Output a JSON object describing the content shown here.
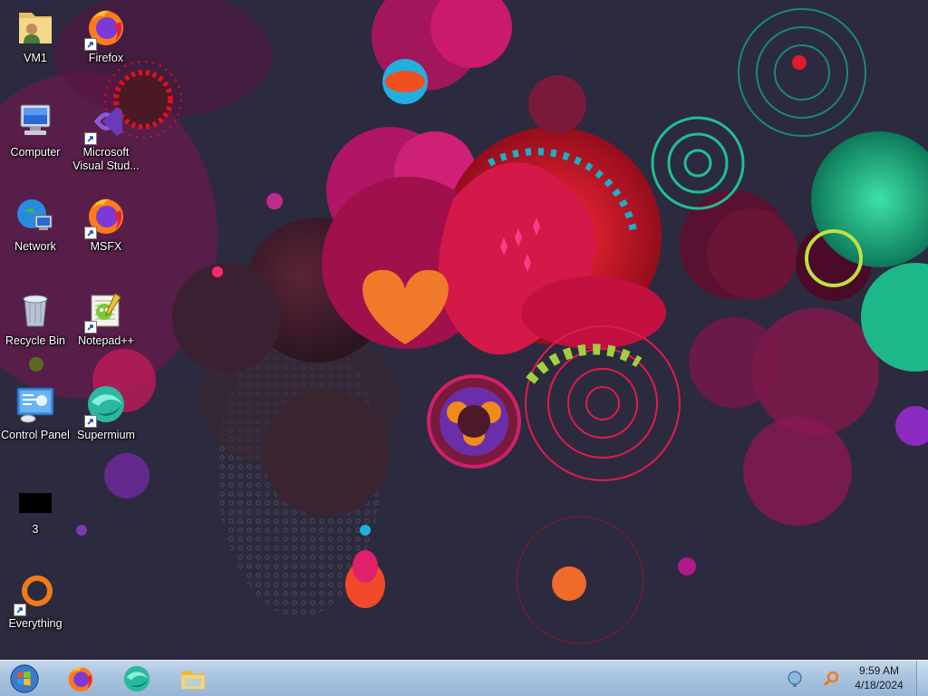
{
  "desktop": {
    "icons": [
      {
        "label": "VM1",
        "icon": "user-folder-icon"
      },
      {
        "label": "Firefox",
        "icon": "firefox-icon"
      },
      {
        "label": "Computer",
        "icon": "computer-icon"
      },
      {
        "label": "Microsoft Visual Stud...",
        "icon": "visual-studio-icon"
      },
      {
        "label": "Network",
        "icon": "network-icon"
      },
      {
        "label": "MSFX",
        "icon": "firefox-icon"
      },
      {
        "label": "Recycle Bin",
        "icon": "recycle-bin-icon"
      },
      {
        "label": "Notepad++",
        "icon": "notepad-plus-plus-icon"
      },
      {
        "label": "Control Panel",
        "icon": "control-panel-icon"
      },
      {
        "label": "Supermium",
        "icon": "supermium-icon"
      },
      {
        "label": "3",
        "icon": "black-file-icon"
      },
      {
        "label": "Everything",
        "icon": "everything-search-icon"
      }
    ]
  },
  "taskbar": {
    "pinned": [
      "firefox-icon",
      "supermium-icon",
      "file-explorer-icon"
    ],
    "tray": [
      "network-status-icon",
      "everything-search-icon"
    ],
    "clock": {
      "time": "9:59 AM",
      "date": "4/18/2024"
    }
  },
  "colors": {
    "taskbar": "#a9c3df",
    "wallpaper_base": "#2c2a3e",
    "accent_magenta": "#c2186b",
    "accent_red": "#e01b2c",
    "accent_teal": "#1db88a",
    "accent_orange": "#f07a2a"
  }
}
